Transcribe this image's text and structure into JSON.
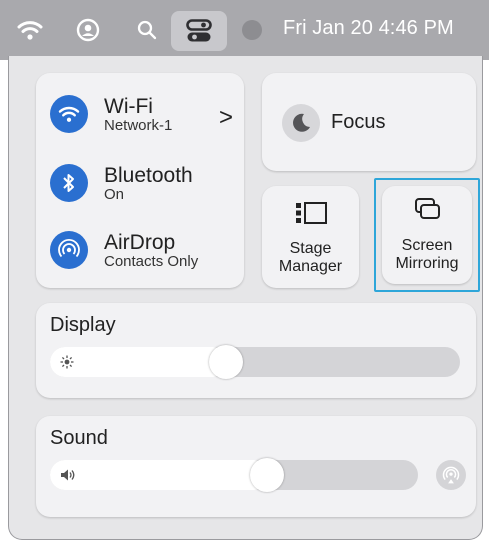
{
  "menubar": {
    "clock": "Fri Jan 20 4:46 PM",
    "icons": [
      "wifi-icon",
      "user-icon",
      "search-icon",
      "control-center-icon",
      "record-dot-icon"
    ]
  },
  "network": {
    "wifi": {
      "title": "Wi-Fi",
      "subtitle": "Network-1"
    },
    "bluetooth": {
      "title": "Bluetooth",
      "subtitle": "On"
    },
    "airdrop": {
      "title": "AirDrop",
      "subtitle": "Contacts Only"
    }
  },
  "focus": {
    "label": "Focus"
  },
  "stage_manager": {
    "line1": "Stage",
    "line2": "Manager"
  },
  "screen_mirroring": {
    "line1": "Screen",
    "line2": "Mirroring"
  },
  "display": {
    "label": "Display",
    "brightness": 0.43
  },
  "sound": {
    "label": "Sound",
    "volume": 0.59
  },
  "colors": {
    "accent_blue": "#2a6fd0",
    "highlight": "#2ea6d9",
    "menubar": "#a9a9ad",
    "panel": "#e6e6e8"
  }
}
